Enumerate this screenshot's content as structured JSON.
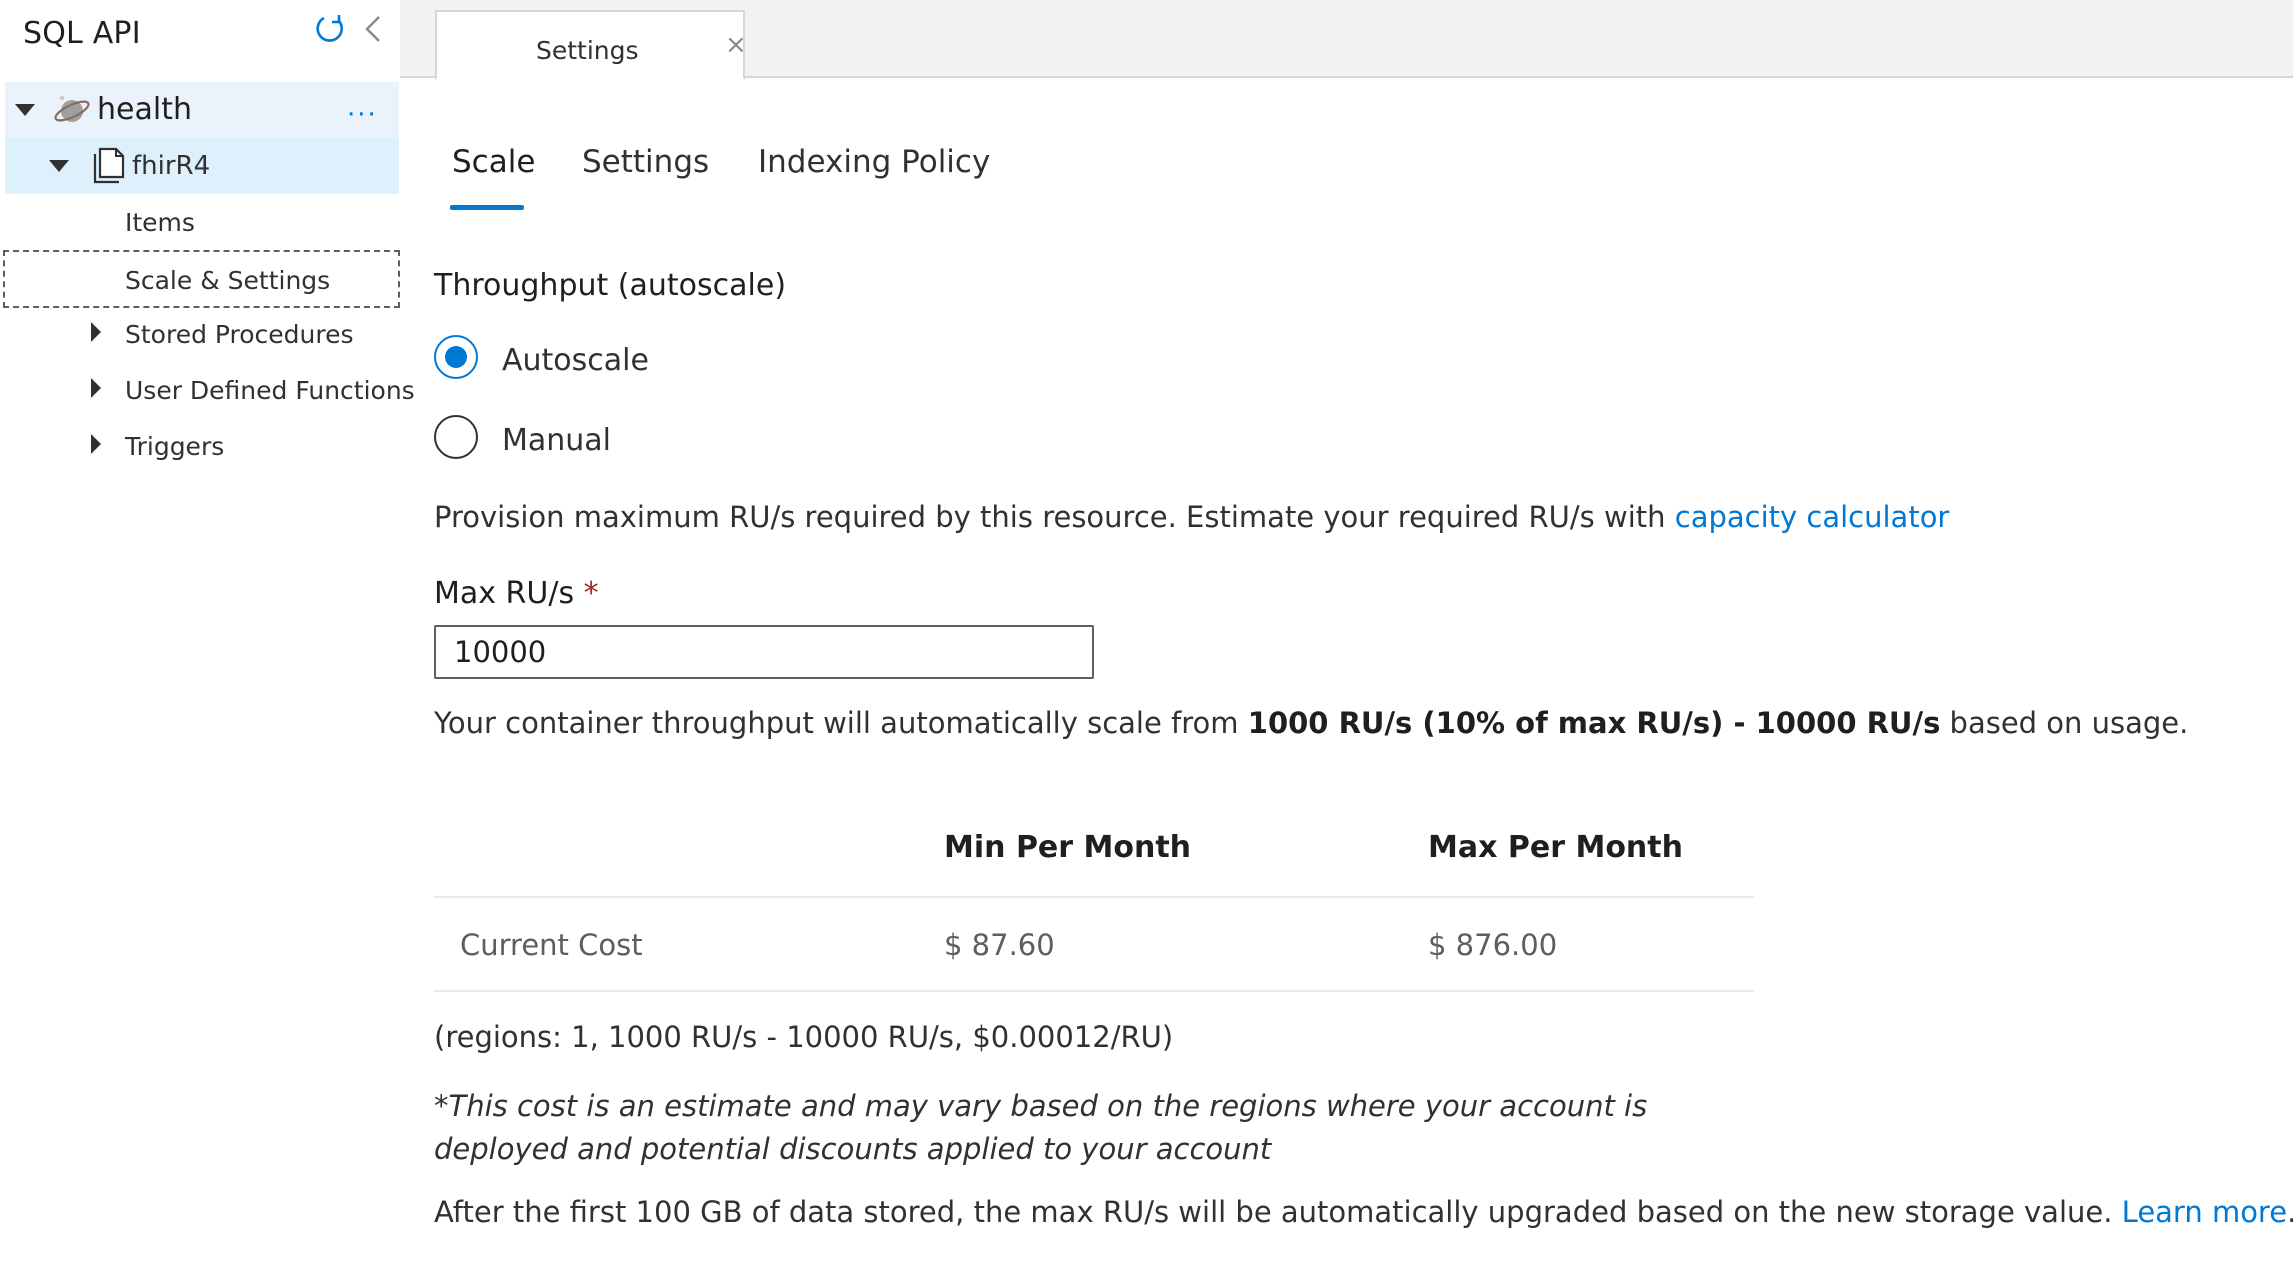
{
  "sidebar": {
    "title": "SQL API",
    "tree": {
      "database": {
        "label": "health",
        "more": "···"
      },
      "collection": {
        "label": "fhirR4"
      },
      "children": [
        {
          "label": "Items"
        },
        {
          "label": "Scale & Settings"
        },
        {
          "label": "Stored Procedures"
        },
        {
          "label": "User Defined Functions"
        },
        {
          "label": "Triggers"
        }
      ]
    }
  },
  "tabs": {
    "document_tab": {
      "label": "Settings",
      "close": "×"
    }
  },
  "subtabs": [
    {
      "label": "Scale"
    },
    {
      "label": "Settings"
    },
    {
      "label": "Indexing Policy"
    }
  ],
  "throughput": {
    "title": "Throughput (autoscale)",
    "options": [
      {
        "label": "Autoscale",
        "checked": true
      },
      {
        "label": "Manual",
        "checked": false
      }
    ],
    "provision_text": "Provision maximum RU/s required by this resource. Estimate your required RU/s with ",
    "provision_link": "capacity calculator",
    "max_label": "Max RU/s",
    "required_mark": "*",
    "max_value": "10000",
    "scale_text_pre": "Your container throughput will automatically scale from ",
    "scale_text_bold": "1000 RU/s (10% of max RU/s) - 10000 RU/s",
    "scale_text_post": " based on usage."
  },
  "cost_table": {
    "headers": [
      "Min Per Month",
      "Max Per Month"
    ],
    "rows": [
      {
        "label": "Current Cost",
        "min": "$ 87.60",
        "max": "$ 876.00"
      }
    ]
  },
  "notes": {
    "regions": "(regions: 1, 1000 RU/s - 10000 RU/s, $0.00012/RU)",
    "estimate": "*This cost is an estimate and may vary based on the regions where your account is deployed and potential discounts applied to your account",
    "after_text": "After the first 100 GB of data stored, the max RU/s will be automatically upgraded based on the new storage value. ",
    "after_link": "Learn more",
    "after_end": "."
  },
  "colors": {
    "accent": "#0078d4",
    "selected_row": "#def0fc",
    "required": "#a4262c"
  },
  "icons": [
    "refresh-icon",
    "collapse-chevron-icon",
    "database-planet-icon",
    "collection-document-icon",
    "more-icon",
    "close-icon"
  ]
}
